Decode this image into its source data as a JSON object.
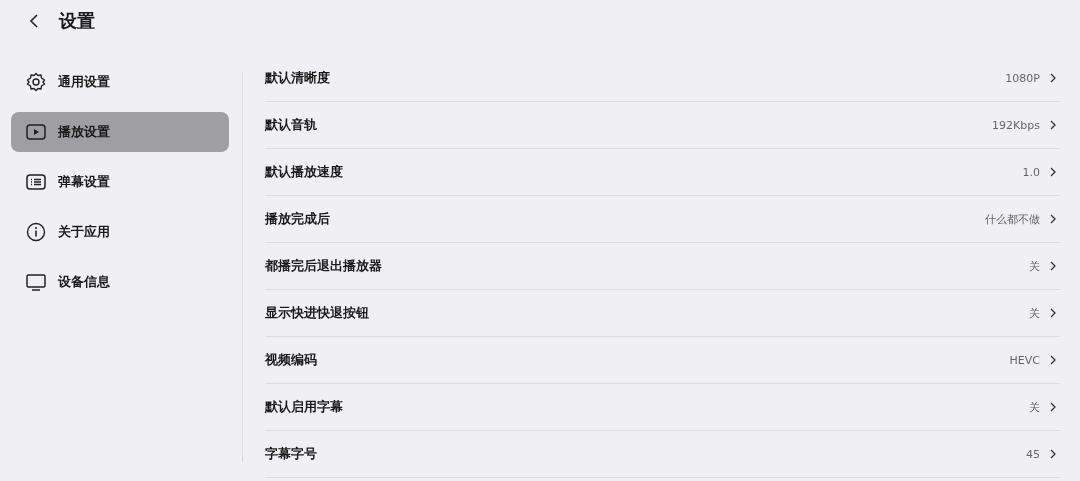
{
  "header": {
    "title": "设置"
  },
  "sidebar": {
    "items": [
      {
        "label": "通用设置",
        "kind": "gear",
        "selected": false
      },
      {
        "label": "播放设置",
        "kind": "play",
        "selected": true
      },
      {
        "label": "弹幕设置",
        "kind": "list",
        "selected": false
      },
      {
        "label": "关于应用",
        "kind": "info",
        "selected": false
      },
      {
        "label": "设备信息",
        "kind": "monitor",
        "selected": false
      }
    ]
  },
  "settings": [
    {
      "label": "默认清晰度",
      "value": "1080P"
    },
    {
      "label": "默认音轨",
      "value": "192Kbps"
    },
    {
      "label": "默认播放速度",
      "value": "1.0"
    },
    {
      "label": "播放完成后",
      "value": "什么都不做"
    },
    {
      "label": "都播完后退出播放器",
      "value": "关"
    },
    {
      "label": "显示快进快退按钮",
      "value": "关"
    },
    {
      "label": "视频编码",
      "value": "HEVC"
    },
    {
      "label": "默认启用字幕",
      "value": "关"
    },
    {
      "label": "字幕字号",
      "value": "45"
    }
  ]
}
